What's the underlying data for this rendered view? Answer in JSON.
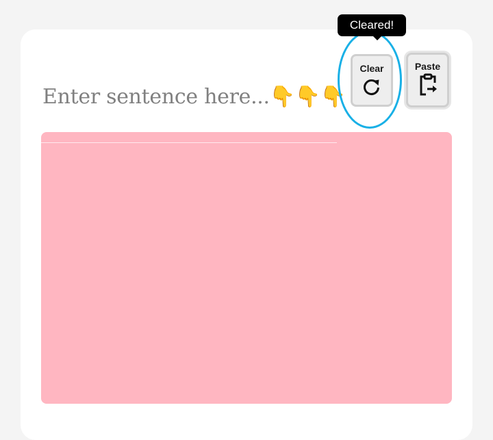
{
  "prompt": {
    "text": "Enter sentence here...",
    "emojis": "👇👇👇"
  },
  "input": {
    "value": "",
    "placeholder": ""
  },
  "buttons": {
    "clear_label": "Clear",
    "clear_icon": "refresh-icon",
    "paste_label": "Paste",
    "paste_icon": "clipboard-paste-icon"
  },
  "tooltip": {
    "text": "Cleared!"
  },
  "colors": {
    "textarea_bg": "#ffb6c1",
    "highlight": "#19b0e6",
    "tooltip_bg": "#000000"
  }
}
